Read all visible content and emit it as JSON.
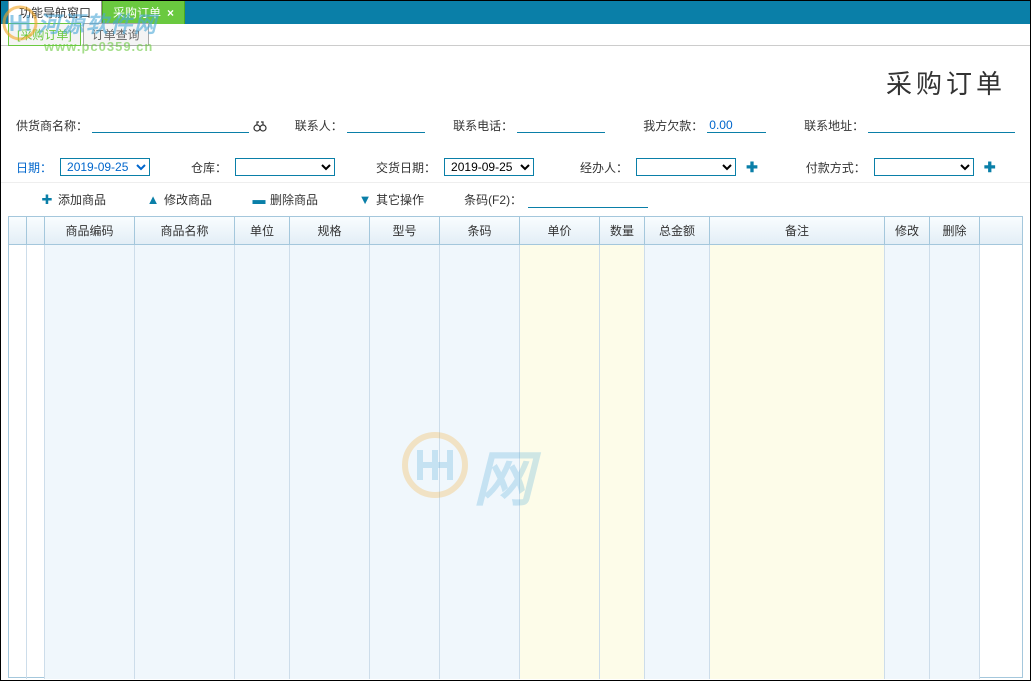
{
  "tabs": {
    "nav": "功能导航窗口",
    "active": "采购订单",
    "close": "×"
  },
  "subtabs": {
    "t1": "[采购订单]",
    "t2": "订单查询"
  },
  "page_title": "采购订单",
  "form": {
    "supplier_label": "供货商名称：",
    "supplier_value": "",
    "contact_label": "联系人：",
    "contact_value": "",
    "phone_label": "联系电话：",
    "phone_value": "",
    "debt_label": "我方欠款：",
    "debt_value": "0.00",
    "address_label": "联系地址：",
    "address_value": "",
    "date_label": "日期：",
    "date_value": "2019-09-25",
    "warehouse_label": "仓库：",
    "warehouse_value": "",
    "delivery_label": "交货日期：",
    "delivery_value": "2019-09-25",
    "agent_label": "经办人：",
    "agent_value": "",
    "payment_label": "付款方式：",
    "payment_value": ""
  },
  "toolbar": {
    "add": "添加商品",
    "edit": "修改商品",
    "delete": "删除商品",
    "other": "其它操作",
    "barcode_label": "条码(F2)："
  },
  "grid_headers": {
    "code": "商品编码",
    "name": "商品名称",
    "unit": "单位",
    "spec": "规格",
    "model": "型号",
    "barcode": "条码",
    "price": "单价",
    "qty": "数量",
    "amount": "总金额",
    "remark": "备注",
    "edit": "修改",
    "del": "删除"
  },
  "watermark": {
    "site_cn": "河源软件网",
    "site_url": "www.pc0359.cn",
    "big": "网"
  }
}
